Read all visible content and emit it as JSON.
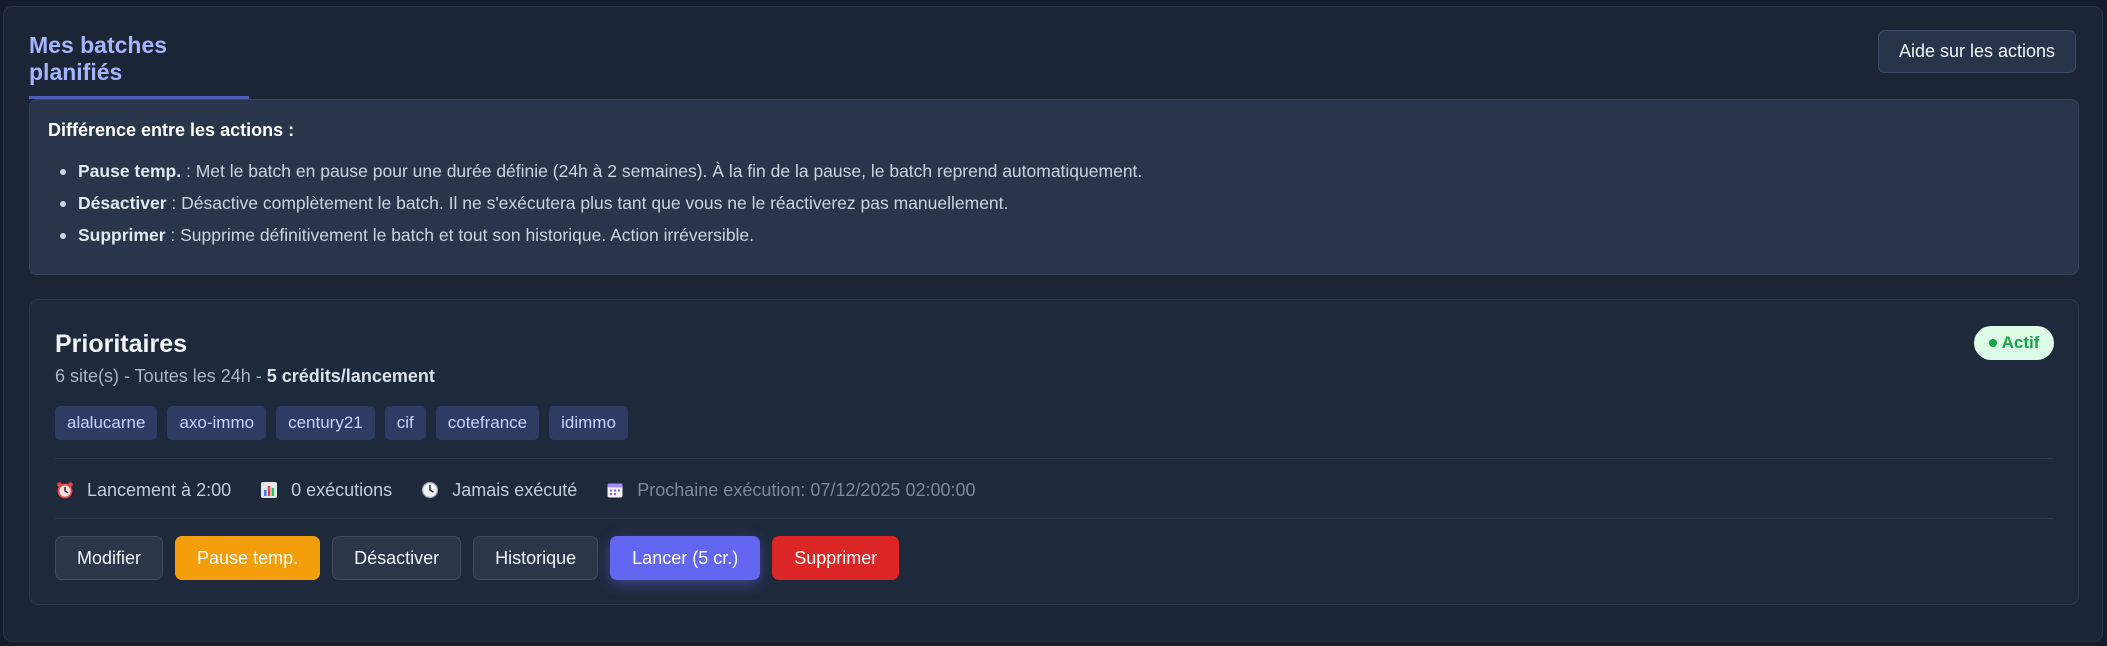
{
  "header": {
    "title": "Mes batches planifiés",
    "help_label": "Aide sur les actions"
  },
  "info": {
    "title": "Différence entre les actions :",
    "items": [
      {
        "term": "Pause temp.",
        "text": " : Met le batch en pause pour une durée définie (24h à 2 semaines). À la fin de la pause, le batch reprend automatiquement."
      },
      {
        "term": "Désactiver",
        "text": " : Désactive complètement le batch. Il ne s'exécutera plus tant que vous ne le réactiverez pas manuellement."
      },
      {
        "term": "Supprimer",
        "text": " : Supprime définitivement le batch et tout son historique. Action irréversible."
      }
    ]
  },
  "batch": {
    "name": "Prioritaires",
    "summary": "6 site(s) - Toutes les 24h - ",
    "credits": "5 crédits/lancement",
    "status": "Actif",
    "status_color": "#16a34a",
    "sites": [
      "alalucarne",
      "axo-immo",
      "century21",
      "cif",
      "cotefrance",
      "idimmo"
    ],
    "meta": {
      "launch": "Lancement à 2:00",
      "executions": "0 exécutions",
      "last_run": "Jamais exécuté",
      "next_run": "Prochaine exécution: 07/12/2025 02:00:00"
    },
    "actions": {
      "edit": "Modifier",
      "pause": "Pause temp.",
      "disable": "Désactiver",
      "history": "Historique",
      "launch": "Lancer (5 cr.)",
      "delete": "Supprimer"
    }
  },
  "colors": {
    "accent": "#6366f1",
    "warning": "#f59e0b",
    "danger": "#dc2626",
    "success": "#16a34a"
  }
}
